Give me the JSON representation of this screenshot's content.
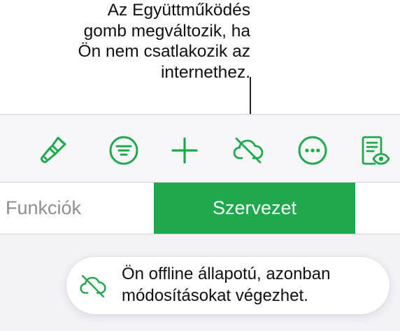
{
  "callout": {
    "lines": [
      "Az Együttműködés",
      "gomb megváltozik, ha",
      "Ön nem csatlakozik az",
      "internethez."
    ]
  },
  "toolbar": {
    "accent_color": "#20a84d",
    "buttons": [
      {
        "name": "format-button",
        "icon": "paintbrush-icon"
      },
      {
        "name": "organize-button",
        "icon": "filter-lines-icon"
      },
      {
        "name": "add-button",
        "icon": "plus-icon"
      },
      {
        "name": "collaboration-button",
        "icon": "cloud-offline-icon"
      },
      {
        "name": "more-button",
        "icon": "ellipsis-circle-icon"
      },
      {
        "name": "reading-view-button",
        "icon": "document-eye-icon"
      }
    ]
  },
  "tabs": {
    "items": [
      {
        "label": "Funkciók",
        "selected": false
      },
      {
        "label": "Szervezet",
        "selected": true
      }
    ],
    "selected_color": "#20a84d"
  },
  "toast": {
    "icon": "cloud-offline-icon",
    "lines": [
      "Ön offline állapotú, azonban",
      "módosításokat végezhet."
    ]
  }
}
